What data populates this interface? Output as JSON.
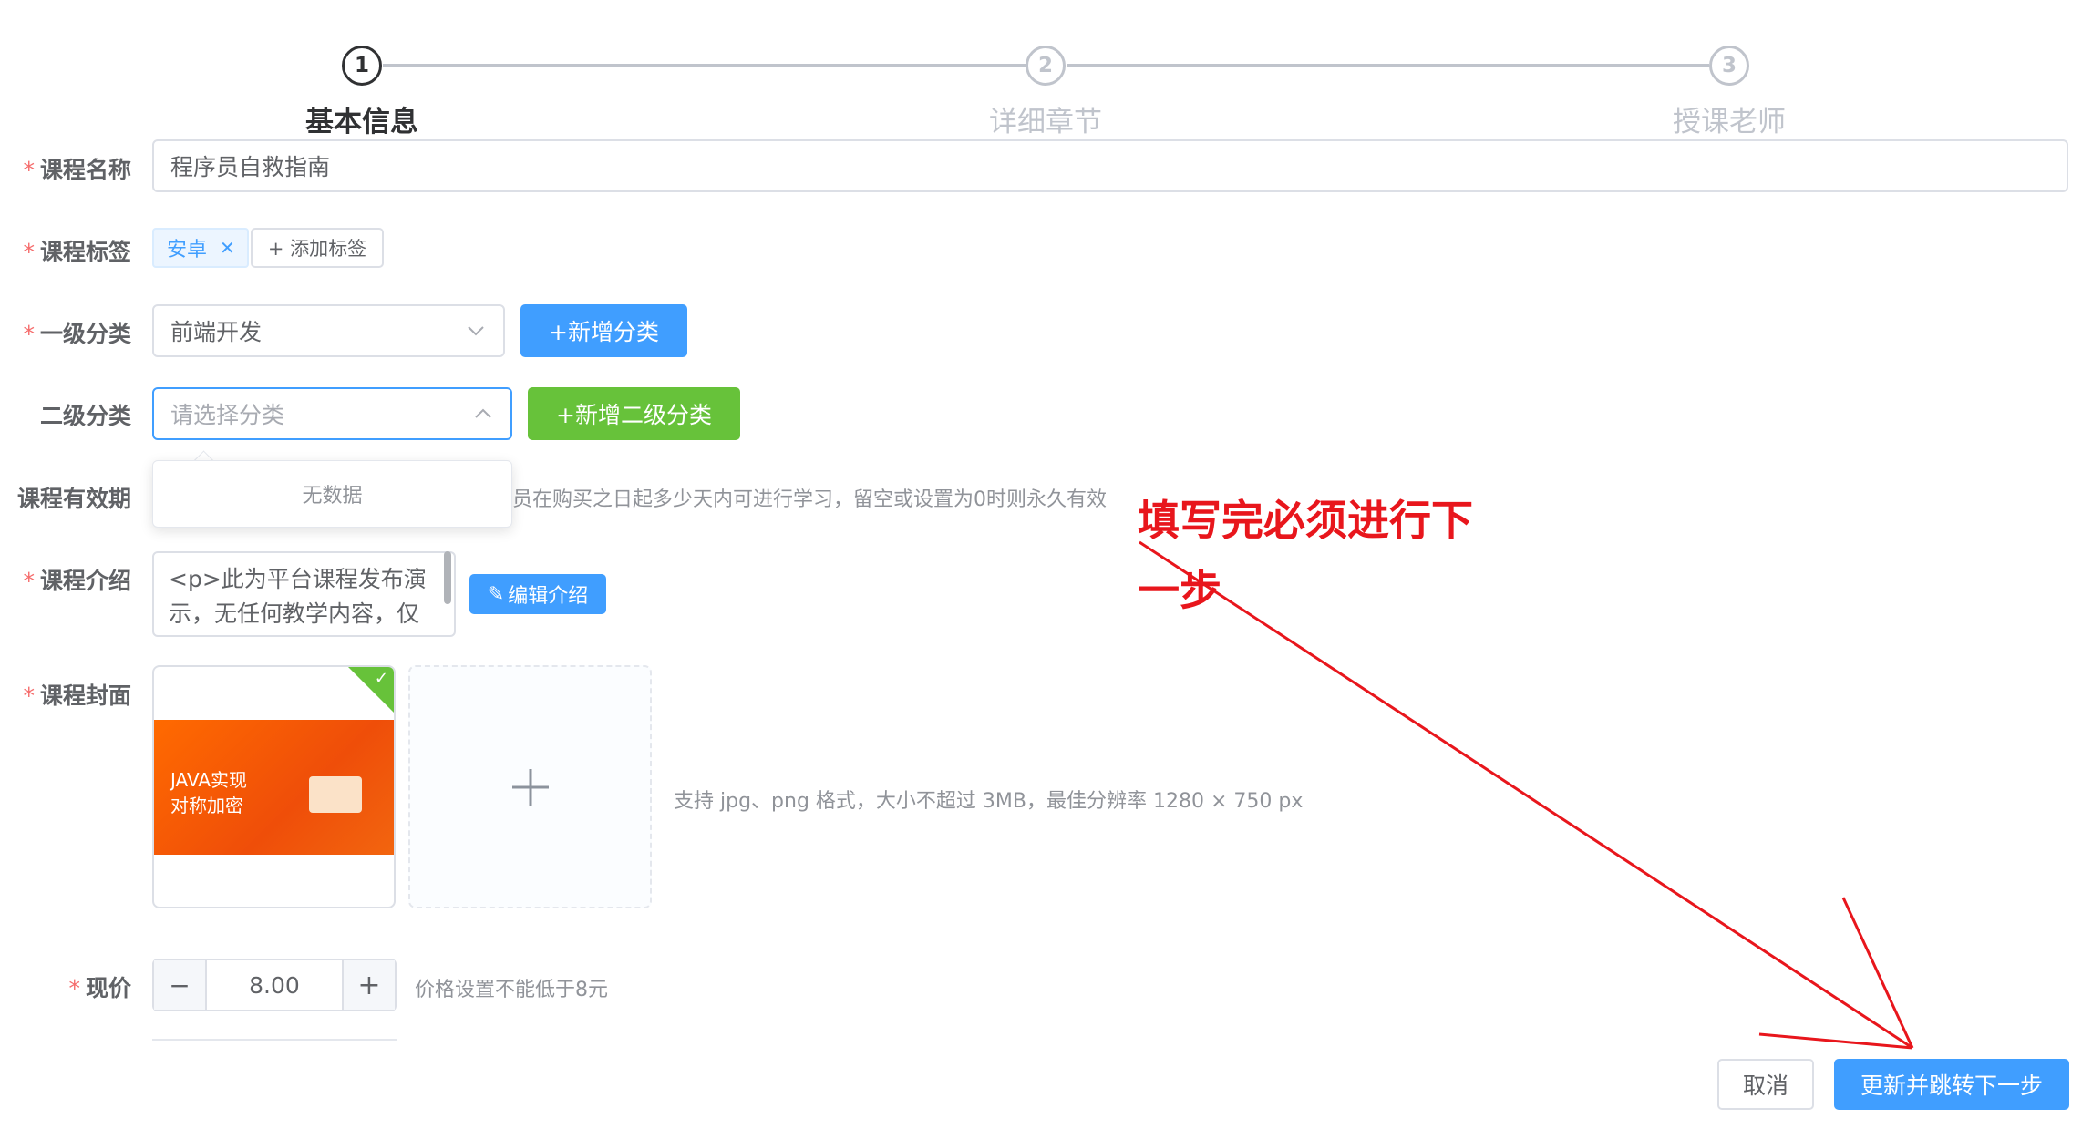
{
  "steps": [
    {
      "number": "1",
      "title": "基本信息",
      "active": true
    },
    {
      "number": "2",
      "title": "详细章节",
      "active": false
    },
    {
      "number": "3",
      "title": "授课老师",
      "active": false
    }
  ],
  "form": {
    "course_name": {
      "label": "课程名称",
      "value": "程序员自救指南"
    },
    "course_tags": {
      "label": "课程标签",
      "tags": [
        "安卓"
      ],
      "add_label": "+ 添加标签"
    },
    "level1": {
      "label": "一级分类",
      "value": "前端开发",
      "add_button": "+新增分类"
    },
    "level2": {
      "label": "二级分类",
      "placeholder": "请选择分类",
      "add_button": "+新增二级分类",
      "dropdown_empty": "无数据"
    },
    "validity": {
      "label": "课程有效期",
      "hint": "学员在购买之日起多少天内可进行学习，留空或设置为0时则永久有效"
    },
    "intro": {
      "label": "课程介绍",
      "value": "<p>此为平台课程发布演示，无任何教学内容，仅供测试",
      "edit_button": "编辑介绍"
    },
    "cover": {
      "label": "课程封面",
      "image_text_line1": "JAVA实现",
      "image_text_line2": "对称加密",
      "hint": "支持 jpg、png 格式，大小不超过 3MB，最佳分辨率 1280 × 750 px"
    },
    "price": {
      "label": "现价",
      "value": "8.00",
      "minus": "−",
      "plus": "+",
      "hint": "价格设置不能低于8元"
    }
  },
  "footer": {
    "cancel": "取消",
    "submit": "更新并跳转下一步"
  },
  "annotation": {
    "line1": "填写完必须进行下",
    "line2": "一步",
    "color": "#e8161c"
  },
  "colors": {
    "primary": "#409eff",
    "success": "#67c23a",
    "required": "#f56c6c"
  }
}
